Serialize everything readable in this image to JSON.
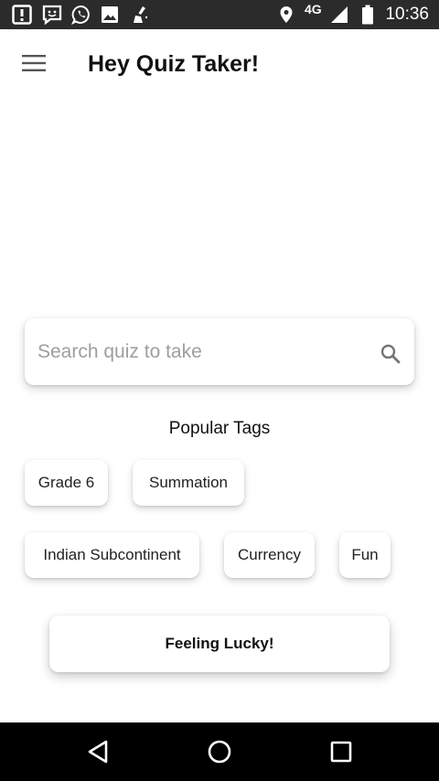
{
  "status_bar": {
    "time": "10:36",
    "network": "4G",
    "icons": [
      "alert-icon",
      "message-icon",
      "whatsapp-icon",
      "image-icon",
      "cleaner-icon",
      "location-icon",
      "signal-icon",
      "battery-icon"
    ]
  },
  "header": {
    "title": "Hey Quiz Taker!",
    "menu_icon": "hamburger-menu-icon"
  },
  "search": {
    "placeholder": "Search quiz to take",
    "value": "",
    "icon": "search-icon"
  },
  "tags": {
    "heading": "Popular Tags",
    "items": [
      "Grade 6",
      "Summation",
      "Indian Subcontinent",
      "Currency",
      "Fun"
    ]
  },
  "lucky_button": {
    "label": "Feeling Lucky!"
  },
  "nav_bar": {
    "icons": [
      "back-icon",
      "home-icon",
      "recents-icon"
    ]
  },
  "colors": {
    "status_bar": "#2b2b2b",
    "nav_bar": "#000000",
    "background": "#ffffff",
    "text": "#111111",
    "placeholder": "#9e9e9e"
  }
}
